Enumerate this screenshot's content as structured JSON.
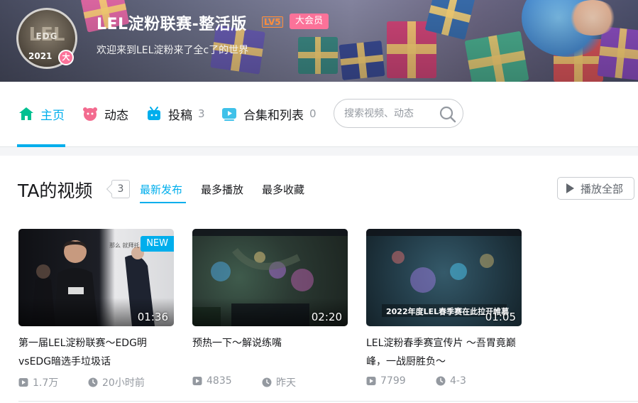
{
  "user": {
    "name": "LEL淀粉联赛-整活版",
    "level": "LV5",
    "vip_label": "大会员",
    "sign": "欢迎来到LEL淀粉来了全c了的世界",
    "avatar_text": "EDG",
    "avatar_logo": "LEL",
    "avatar_year": "2021",
    "avatar_badge": "大"
  },
  "nav": {
    "items": [
      {
        "label": "主页",
        "icon": "home-icon",
        "count": ""
      },
      {
        "label": "动态",
        "icon": "dynamic-icon",
        "count": ""
      },
      {
        "label": "投稿",
        "icon": "upload-icon",
        "count": "3"
      },
      {
        "label": "合集和列表",
        "icon": "collection-icon",
        "count": "0"
      }
    ],
    "search_placeholder": "搜索视频、动态"
  },
  "section": {
    "title": "TA的视频",
    "count": "3",
    "sorts": [
      "最新发布",
      "最多播放",
      "最多收藏"
    ],
    "play_all": "播放全部"
  },
  "videos": [
    {
      "title": "第一届LEL淀粉联赛～EDG明vsEDG暗选手垃圾话",
      "duration": "01:36",
      "plays": "1.7万",
      "time": "20小时前",
      "tag": "NEW",
      "thumb_caption": "那么 就拜托"
    },
    {
      "title": "预热一下～解说练嘴",
      "duration": "02:20",
      "plays": "4835",
      "time": "昨天",
      "tag": ""
    },
    {
      "title": "LEL淀粉春季赛宣传片 ～吾胃竟巅峰，一战厨胜负～",
      "duration": "01:05",
      "plays": "7799",
      "time": "4-3",
      "tag": "",
      "thumb_caption": "2022年度LEL春季赛在此拉开帷幕"
    }
  ],
  "colors": {
    "accent": "#00aeec",
    "vip": "#fb7299",
    "level": "#ff8d3a",
    "muted": "#9499a0"
  }
}
